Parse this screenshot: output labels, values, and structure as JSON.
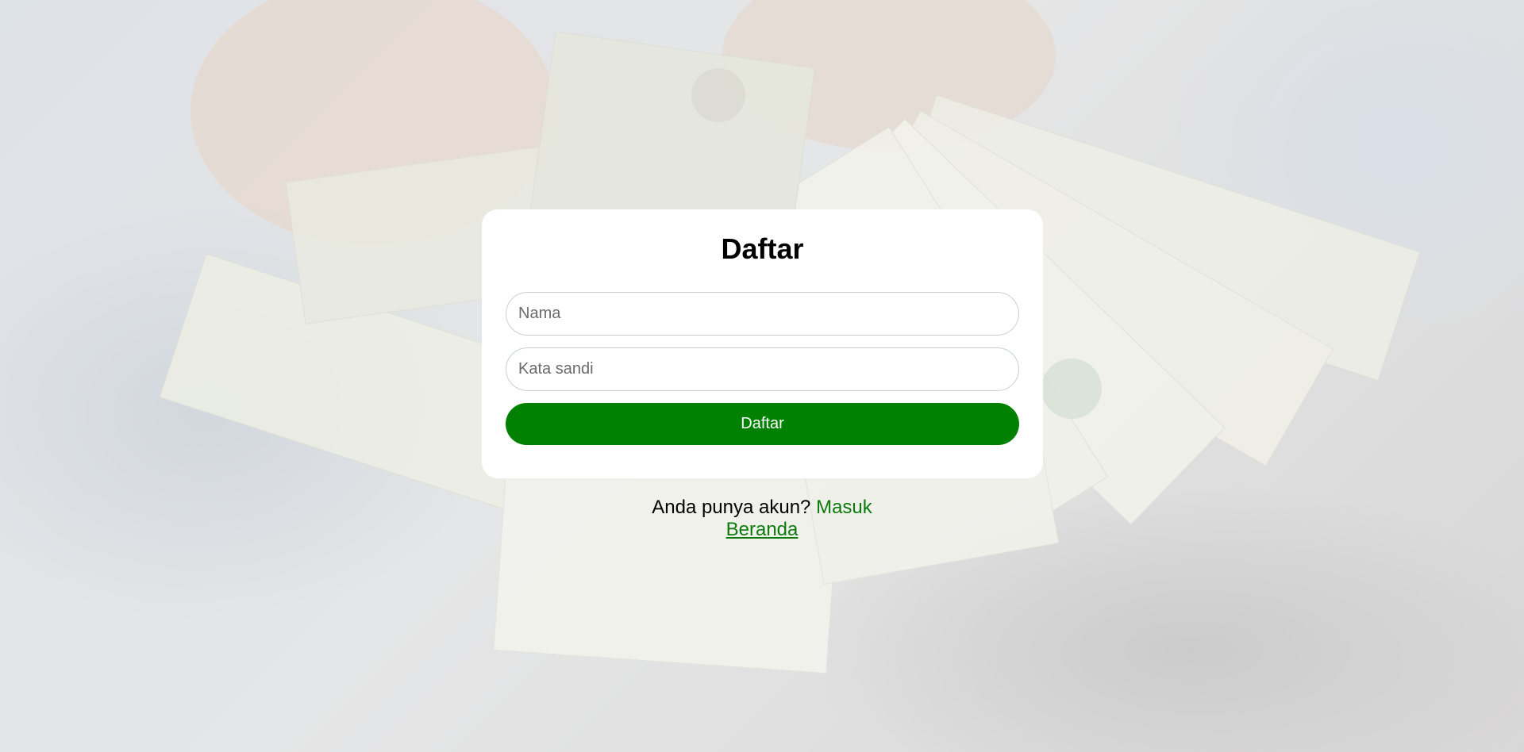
{
  "form": {
    "title": "Daftar",
    "name_placeholder": "Nama",
    "password_placeholder": "Kata sandi",
    "submit_label": "Daftar"
  },
  "footer": {
    "question_text": "Anda punya akun?",
    "login_link": "Masuk",
    "home_link": "Beranda"
  },
  "colors": {
    "accent": "#018001",
    "link": "#0b7a0b",
    "card": "#ffffff"
  }
}
